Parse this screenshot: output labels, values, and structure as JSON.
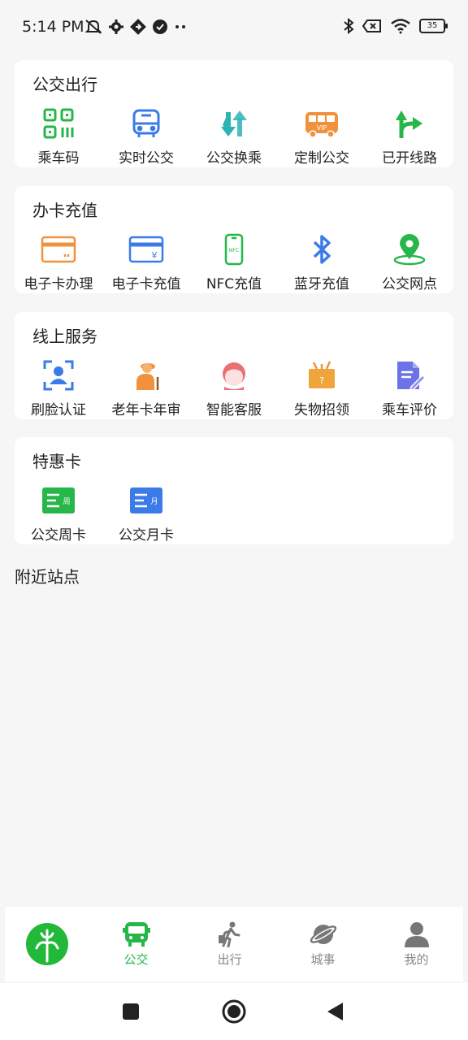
{
  "status_bar": {
    "time": "5:14 PM",
    "battery": "35",
    "icons": [
      "mute-icon",
      "settings-icon",
      "sync-icon",
      "check-circle-icon",
      "more-dots-icon",
      "bluetooth-icon",
      "data-off-icon",
      "wifi-icon",
      "battery-icon"
    ]
  },
  "sections": [
    {
      "title": "公交出行",
      "items": [
        {
          "label": "乘车码",
          "icon": "qr-code-icon"
        },
        {
          "label": "实时公交",
          "icon": "bus-front-icon"
        },
        {
          "label": "公交换乘",
          "icon": "transfer-arrows-icon"
        },
        {
          "label": "定制公交",
          "icon": "vip-bus-icon"
        },
        {
          "label": "已开线路",
          "icon": "route-arrow-icon"
        }
      ]
    },
    {
      "title": "办卡充值",
      "items": [
        {
          "label": "电子卡办理",
          "icon": "card-icon"
        },
        {
          "label": "电子卡充值",
          "icon": "card-yuan-icon"
        },
        {
          "label": "NFC充值",
          "icon": "nfc-phone-icon"
        },
        {
          "label": "蓝牙充值",
          "icon": "bluetooth-icon"
        },
        {
          "label": "公交网点",
          "icon": "location-pin-icon"
        }
      ]
    },
    {
      "title": "线上服务",
      "items": [
        {
          "label": "刷脸认证",
          "icon": "face-scan-icon"
        },
        {
          "label": "老年卡年审",
          "icon": "elderly-icon"
        },
        {
          "label": "智能客服",
          "icon": "customer-service-icon"
        },
        {
          "label": "失物招领",
          "icon": "lost-box-icon"
        },
        {
          "label": "乘车评价",
          "icon": "review-doc-icon"
        }
      ]
    },
    {
      "title": "特惠卡",
      "items": [
        {
          "label": "公交周卡",
          "icon": "week-card-icon"
        },
        {
          "label": "公交月卡",
          "icon": "month-card-icon"
        }
      ]
    }
  ],
  "nearby_title": "附近站点",
  "tabbar": {
    "tabs": [
      {
        "label": "公交",
        "icon": "bus-tab-icon",
        "active": true
      },
      {
        "label": "出行",
        "icon": "walker-icon",
        "active": false
      },
      {
        "label": "城事",
        "icon": "planet-icon",
        "active": false
      },
      {
        "label": "我的",
        "icon": "user-icon",
        "active": false
      }
    ]
  },
  "colors": {
    "green": "#27b64a",
    "teal": "#2cb3b6",
    "blue": "#3a7be8",
    "orange": "#f0913c",
    "pink": "#ec6f73",
    "purple": "#6c73e6"
  }
}
